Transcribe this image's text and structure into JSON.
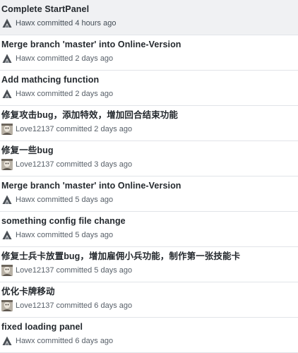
{
  "commits": [
    {
      "title": "Complete StartPanel",
      "author": "Hawx",
      "when": "4 hours ago",
      "avatar": "hawx-logo-icon",
      "selected": true
    },
    {
      "title": "Merge branch 'master' into Online-Version",
      "author": "Hawx",
      "when": "2 days ago",
      "avatar": "hawx-logo-icon",
      "selected": false
    },
    {
      "title": "Add mathcing function",
      "author": "Hawx",
      "when": "2 days ago",
      "avatar": "hawx-logo-icon",
      "selected": false
    },
    {
      "title": "修复攻击bug，添加特效，增加回合结束功能",
      "author": "Love12137",
      "when": "2 days ago",
      "avatar": "photo-avatar-icon",
      "selected": false
    },
    {
      "title": "修复一些bug",
      "author": "Love12137",
      "when": "3 days ago",
      "avatar": "photo-avatar-icon",
      "selected": false
    },
    {
      "title": "Merge branch 'master' into Online-Version",
      "author": "Hawx",
      "when": "5 days ago",
      "avatar": "hawx-logo-icon",
      "selected": false
    },
    {
      "title": "something config file change",
      "author": "Hawx",
      "when": "5 days ago",
      "avatar": "hawx-logo-icon",
      "selected": false
    },
    {
      "title": "修复士兵卡放置bug，增加雇佣小兵功能，制作第一张技能卡",
      "author": "Love12137",
      "when": "5 days ago",
      "avatar": "photo-avatar-icon",
      "selected": false
    },
    {
      "title": "优化卡牌移动",
      "author": "Love12137",
      "when": "6 days ago",
      "avatar": "photo-avatar-icon",
      "selected": false
    },
    {
      "title": "fixed loading panel",
      "author": "Hawx",
      "when": "6 days ago",
      "avatar": "hawx-logo-icon",
      "selected": false
    }
  ],
  "meta_verb": "committed"
}
